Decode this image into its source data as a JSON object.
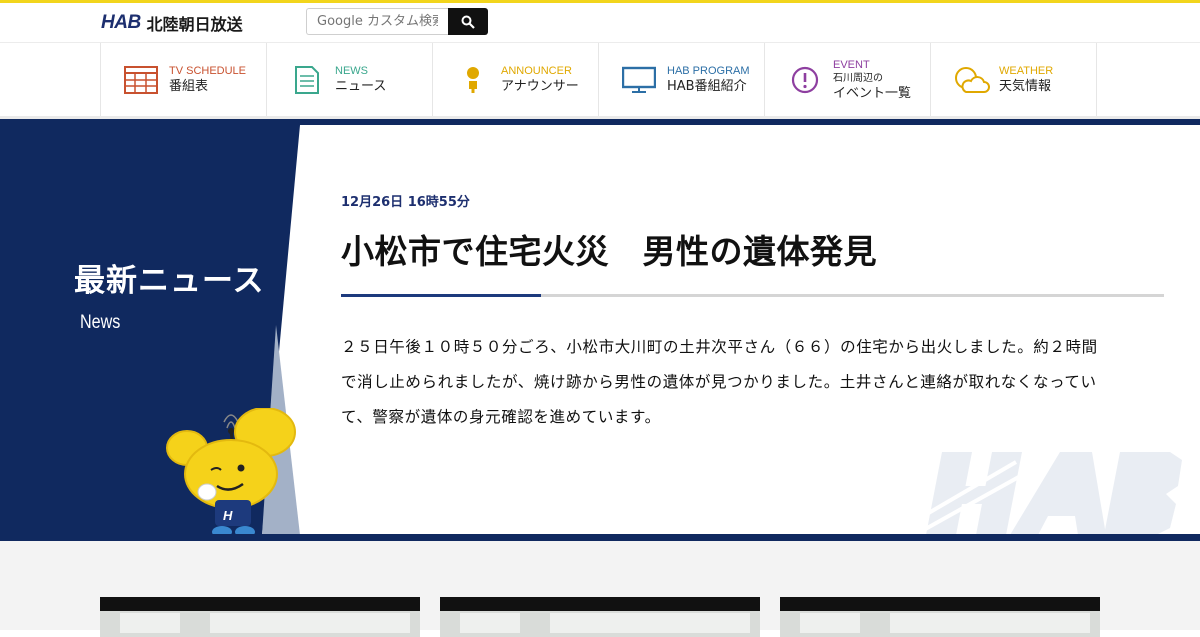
{
  "header": {
    "logo_mark": "HAB",
    "logo_name": "北陸朝日放送",
    "search_placeholder": "Google カスタム検索",
    "search_icon": "search-icon"
  },
  "nav": [
    {
      "en": "TV SCHEDULE",
      "jp": "番組表",
      "icon": "tv-schedule-icon",
      "color": "#c8512f"
    },
    {
      "en": "NEWS",
      "jp": "ニュース",
      "icon": "news-document-icon",
      "color": "#3aa78d"
    },
    {
      "en": "ANNOUNCER",
      "jp": "アナウンサー",
      "icon": "announcer-person-icon",
      "color": "#e0a800"
    },
    {
      "en": "HAB PROGRAM",
      "jp": "HAB番組紹介",
      "icon": "tv-monitor-icon",
      "color": "#2c6fa6"
    },
    {
      "en": "EVENT",
      "jp_small": "石川周辺の",
      "jp": "イベント一覧",
      "icon": "exclamation-circle-icon",
      "color": "#8e3fa0"
    },
    {
      "en": "WEATHER",
      "jp": "天気情報",
      "icon": "weather-sun-cloud-icon",
      "color": "#e0a800"
    }
  ],
  "section": {
    "title": "最新ニュース",
    "subtitle": "News"
  },
  "article": {
    "date": "12月26日 16時55分",
    "headline": "小松市で住宅火災　男性の遺体発見",
    "body": "２５日午後１０時５０分ごろ、小松市大川町の土井次平さん（６６）の住宅から出火しました。約２時間で消し止められましたが、焼け跡から男性の遺体が見つかりました。土井さんと連絡が取れなくなっていて、警察が遺体の身元確認を進めています。"
  },
  "watermark": "HAB",
  "colors": {
    "navy": "#10295f",
    "accent_yellow": "#f2d51c",
    "rule_blue": "#1d3a7d"
  }
}
